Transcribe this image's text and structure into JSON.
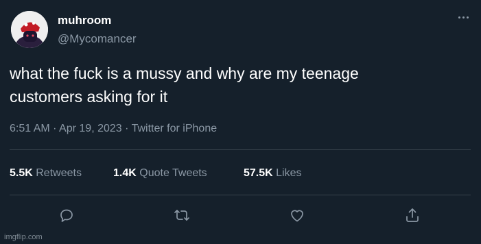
{
  "author": {
    "display_name": "muhroom",
    "handle": "@Mycomancer",
    "avatar_icon": "mushroom-character-avatar"
  },
  "tweet": {
    "text_line1": "what the fuck is a mussy and why are my teenage",
    "text_line2": "customers asking for it"
  },
  "meta": {
    "time": "6:51 AM",
    "sep1": " · ",
    "date": "Apr 19, 2023",
    "sep2": " · ",
    "source": "Twitter for iPhone"
  },
  "stats": {
    "retweets_count": "5.5K",
    "retweets_label": "Retweets",
    "quotes_count": "1.4K",
    "quotes_label": "Quote Tweets",
    "likes_count": "57.5K",
    "likes_label": "Likes"
  },
  "actions": {
    "reply_icon": "reply-icon",
    "retweet_icon": "retweet-icon",
    "like_icon": "heart-icon",
    "share_icon": "share-icon"
  },
  "watermark": "imgflip.com",
  "colors": {
    "background": "#15202b",
    "primary_text": "#ffffff",
    "secondary_text": "#8b98a5",
    "divider": "#38444d"
  }
}
